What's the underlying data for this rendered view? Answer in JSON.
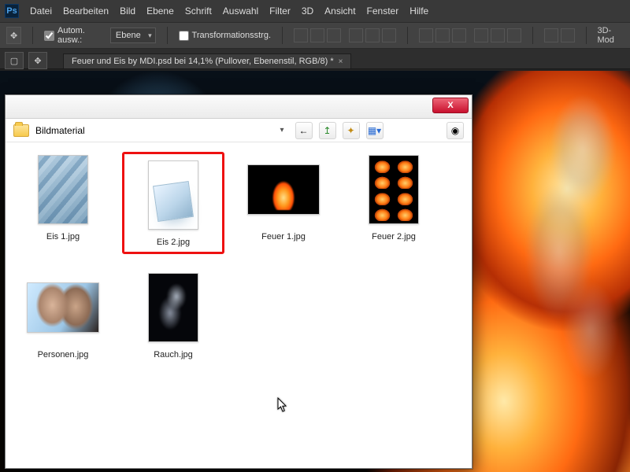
{
  "app": {
    "ps_badge": "Ps"
  },
  "menu": {
    "datei": "Datei",
    "bearbeiten": "Bearbeiten",
    "bild": "Bild",
    "ebene": "Ebene",
    "schrift": "Schrift",
    "auswahl": "Auswahl",
    "filter": "Filter",
    "dreid": "3D",
    "ansicht": "Ansicht",
    "fenster": "Fenster",
    "hilfe": "Hilfe"
  },
  "options": {
    "autom": "Autom. ausw.:",
    "layer_dd": "Ebene",
    "transform": "Transformationsstrg.",
    "mode3d": "3D-Mod"
  },
  "tab": {
    "title": "Feuer und Eis by MDI.psd bei 14,1% (Pullover, Ebenenstil, RGB/8) *",
    "close": "×"
  },
  "dialog": {
    "folder": "Bildmaterial",
    "close_glyph": "X",
    "back_glyph": "←",
    "up_glyph": "↥",
    "newfolder_glyph": "✦",
    "view_glyph": "▦▾",
    "camera_glyph": "◉"
  },
  "files": {
    "eis1": "Eis 1.jpg",
    "eis2": "Eis 2.jpg",
    "feuer1": "Feuer 1.jpg",
    "feuer2": "Feuer 2.jpg",
    "personen": "Personen.jpg",
    "rauch": "Rauch.jpg"
  }
}
